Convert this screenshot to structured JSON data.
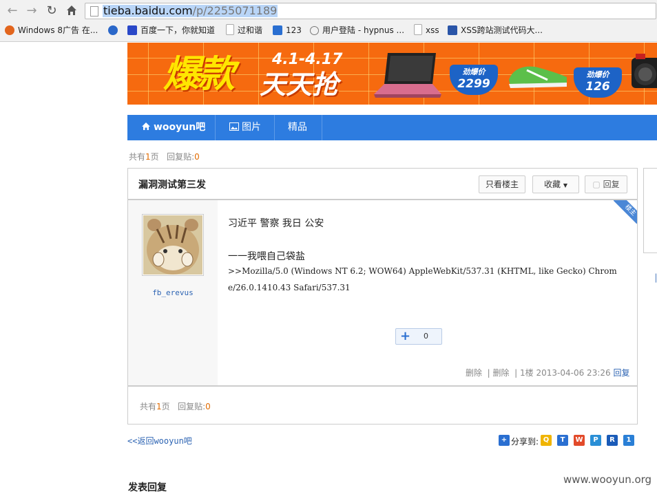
{
  "browser": {
    "url_host": "tieba.baidu.com",
    "url_path": "/p/2255071189",
    "bookmarks": [
      {
        "label": "Windows 8广告 在...",
        "color": "#e2651d"
      },
      {
        "label": "",
        "color": "#2a67c9"
      },
      {
        "label": "百度一下，你就知道",
        "color": "#2a48c8"
      },
      {
        "label": "过和谐",
        "color": "#d8d8d8"
      },
      {
        "label": "123",
        "color": "#2a6fd1"
      },
      {
        "label": "用户登陆 - hypnus ...",
        "color": "#ffffff"
      },
      {
        "label": "xss",
        "color": "#d8d8d8"
      },
      {
        "label": "XSS跨站测试代码大...",
        "color": "#2a55a8"
      }
    ]
  },
  "banner": {
    "big": "爆款",
    "date": "4.1-4.17",
    "sub": "天天抢",
    "tag_label": "劲爆价",
    "price1": "2299",
    "price2": "126"
  },
  "nav": {
    "home": "wooyun吧",
    "pics": "图片",
    "best": "精品"
  },
  "stats_top": {
    "pages_pre": "共有",
    "pages": "1",
    "pages_post": "页",
    "replies_label": "回复贴:",
    "replies": "0"
  },
  "thread": {
    "title": "漏洞测试第三发",
    "btn_owner": "只看楼主",
    "btn_fav": "收藏",
    "btn_reply": "回复",
    "ribbon": "楼主",
    "username": "fb_erevus",
    "line1": "习近平 警察 我日 公安",
    "line2": "一一我喂自己袋盐",
    "line3": ">>Mozilla/5.0 (Windows NT 6.2; WOW64) AppleWebKit/537.31 (KHTML, like Gecko) Chrom",
    "line4": "e/26.0.1410.43 Safari/537.31",
    "vote_count": "0",
    "del1": "删除",
    "del2": "删除",
    "floor": "1楼",
    "time": "2013-04-06 23:26",
    "reply_link": "回复"
  },
  "stats_bottom": {
    "pages_pre": "共有",
    "pages": "1",
    "pages_post": "页",
    "replies_label": "回复贴:",
    "replies": "0"
  },
  "footer": {
    "back": "<<返回wooyun吧",
    "share": "分享到:",
    "reply_head": "发表回复",
    "watermark": "www.wooyun.org"
  }
}
